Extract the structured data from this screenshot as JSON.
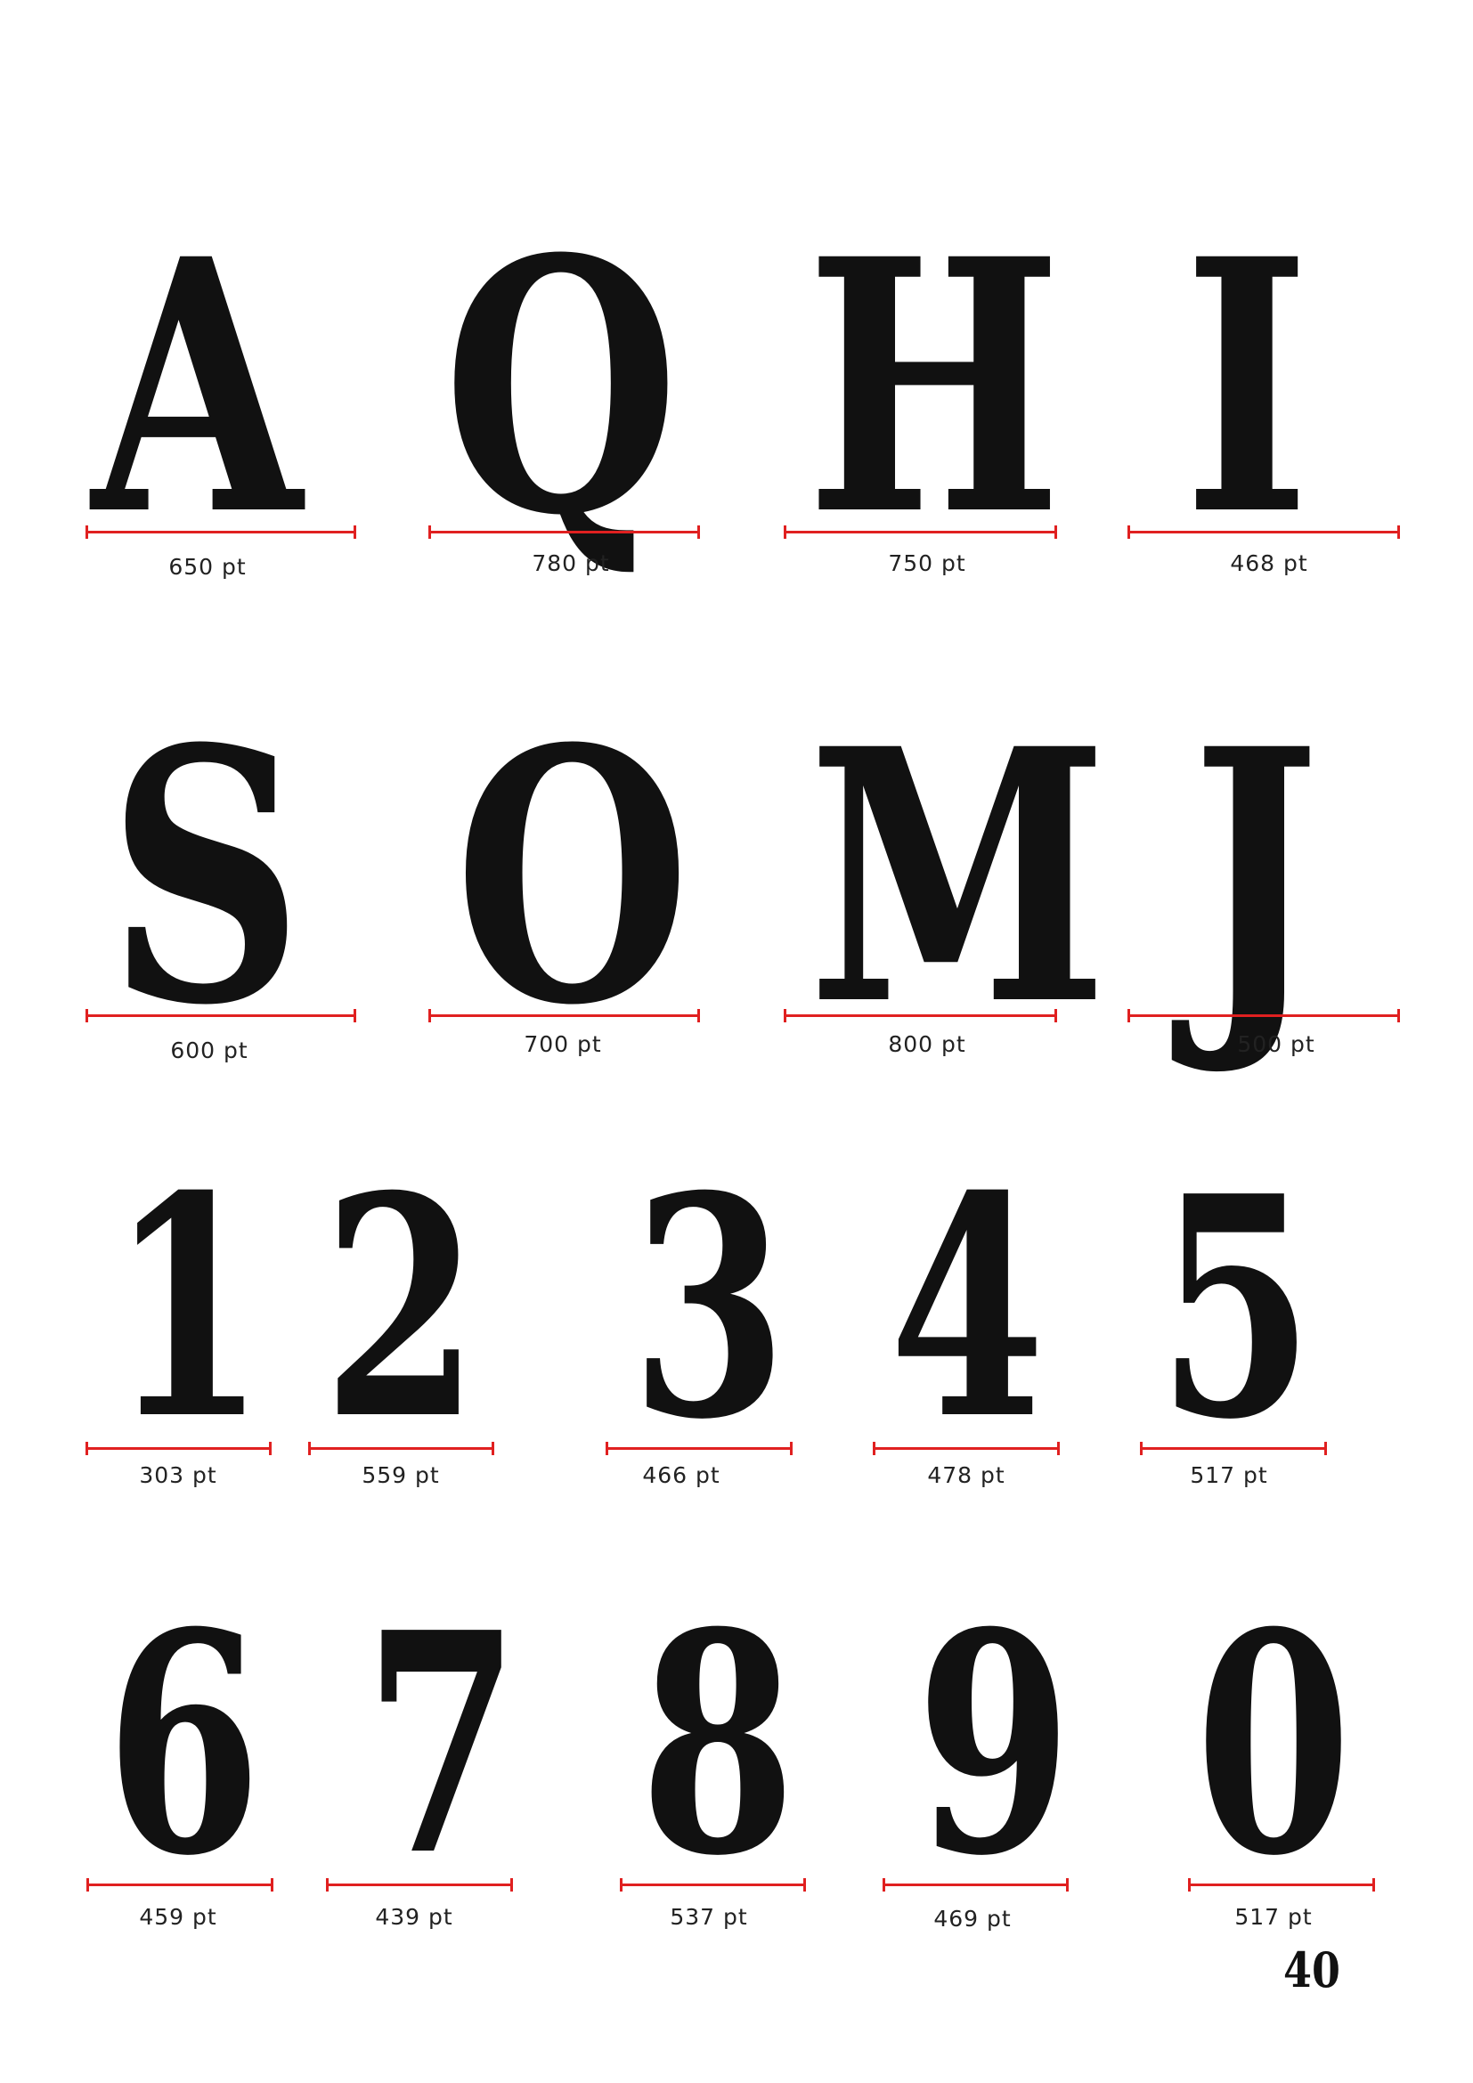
{
  "colors": {
    "glyph": "#111111",
    "ruler": "#e02020",
    "label": "#222222",
    "background": "#ffffff"
  },
  "rows": [
    {
      "type": "letters",
      "items": [
        {
          "glyph": "A",
          "width_label": "650 pt"
        },
        {
          "glyph": "Q",
          "width_label": "780 pt"
        },
        {
          "glyph": "H",
          "width_label": "750 pt"
        },
        {
          "glyph": "I",
          "width_label": "468 pt"
        }
      ]
    },
    {
      "type": "letters",
      "items": [
        {
          "glyph": "S",
          "width_label": "600 pt"
        },
        {
          "glyph": "O",
          "width_label": "700 pt"
        },
        {
          "glyph": "M",
          "width_label": "800 pt"
        },
        {
          "glyph": "J",
          "width_label": "500 pt"
        }
      ]
    },
    {
      "type": "digits",
      "items": [
        {
          "glyph": "1",
          "width_label": "303 pt"
        },
        {
          "glyph": "2",
          "width_label": "559 pt"
        },
        {
          "glyph": "3",
          "width_label": "466 pt"
        },
        {
          "glyph": "4",
          "width_label": "478 pt"
        },
        {
          "glyph": "5",
          "width_label": "517 pt"
        }
      ]
    },
    {
      "type": "digits",
      "items": [
        {
          "glyph": "6",
          "width_label": "459 pt"
        },
        {
          "glyph": "7",
          "width_label": "439 pt"
        },
        {
          "glyph": "8",
          "width_label": "537 pt"
        },
        {
          "glyph": "9",
          "width_label": "469 pt"
        },
        {
          "glyph": "0",
          "width_label": "517 pt"
        }
      ]
    }
  ],
  "page_number": "40"
}
